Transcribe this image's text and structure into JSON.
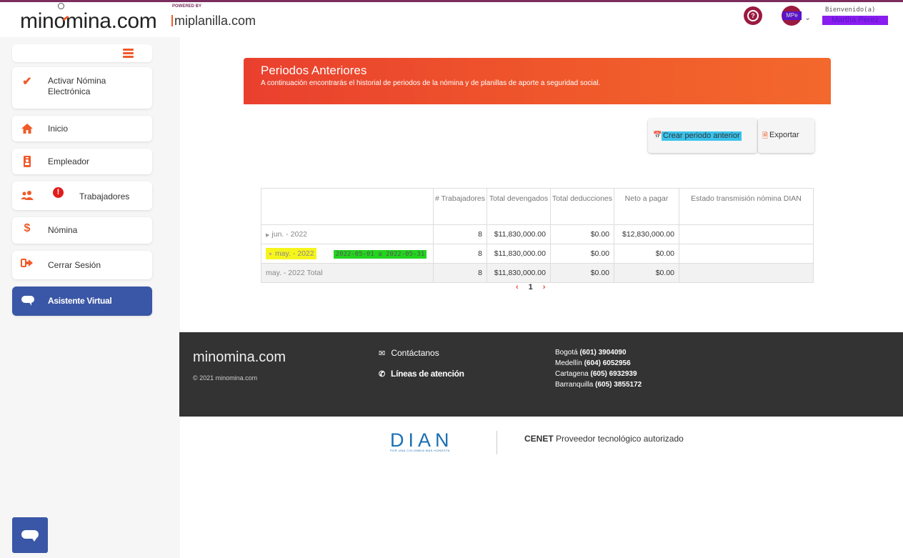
{
  "header": {
    "brand": {
      "part1": "min",
      "part2": "mina.com"
    },
    "powered_by": "POWERED BY",
    "partner": "miplanilla.com",
    "welcome": "Bienvenido(a)",
    "user_name": "Martha Perez",
    "avatar_tag": "MPe"
  },
  "sidebar": {
    "items": [
      {
        "label": "Activar Nómina Electrónica",
        "icon": "check-icon"
      },
      {
        "label": "Inicio",
        "icon": "home-icon"
      },
      {
        "label": "Empleador",
        "icon": "id-badge-icon"
      },
      {
        "label": "Trabajadores",
        "icon": "users-icon"
      },
      {
        "label": "Nómina",
        "icon": "dollar-icon"
      },
      {
        "label": "Cerrar Sesión",
        "icon": "sign-out-icon"
      },
      {
        "label": "Asistente Virtual",
        "icon": "chat-bubble-icon"
      }
    ],
    "alert_badge": "!"
  },
  "main": {
    "title": "Periodos Anteriores",
    "subtitle": "A continuación encontrarás el historial de periodos de la nómina y de planillas de aporte a seguridad social.",
    "create_button": "Crear periodo anterior",
    "export_button": "Exportar",
    "table": {
      "headers": [
        "",
        "# Trabajadores",
        "Total devengados",
        "Total deducciones",
        "Neto a pagar",
        "Estado transmisión nómina DIAN"
      ],
      "rows": [
        {
          "period": "jun. - 2022",
          "range": "",
          "workers": "8",
          "devengados": "$11,830,000.00",
          "deducciones": "$0.00",
          "neto": "$12,830,000.00",
          "estado": ""
        },
        {
          "period": "may. - 2022",
          "range": "2022-05-01 a  2022-05-31",
          "workers": "8",
          "devengados": "$11,830,000.00",
          "deducciones": "$0.00",
          "neto": "$0.00",
          "estado": ""
        },
        {
          "period": "may. - 2022 Total",
          "range": "",
          "workers": "8",
          "devengados": "$11,830,000.00",
          "deducciones": "$0.00",
          "neto": "$0.00",
          "estado": ""
        }
      ]
    },
    "pager": {
      "prev": "‹",
      "page": "1",
      "next": "›"
    }
  },
  "footer": {
    "logo": {
      "part1": "min",
      "part2": "mina.com"
    },
    "copyright": "© 2021 minomina.com",
    "contact": "Contáctanos",
    "lines": "Líneas de atención",
    "phones": [
      {
        "city": "Bogotá",
        "number": "(601) 3904090"
      },
      {
        "city": "Medellín",
        "number": "(604) 6052956"
      },
      {
        "city": "Cartagena",
        "number": "(605) 6932939"
      },
      {
        "city": "Barranquilla",
        "number": "(605) 3855172"
      }
    ],
    "dian": "DIAN",
    "dian_tagline": "POR UNA COLOMBIA MÁS HONESTA",
    "cenet_brand": "CENET",
    "cenet_text": "Proveedor tecnológico autorizado"
  },
  "colors": {
    "accent": "#f05a28",
    "brand": "#7b2d5e",
    "nav_active": "#3a56a6",
    "footer": "#333333"
  }
}
